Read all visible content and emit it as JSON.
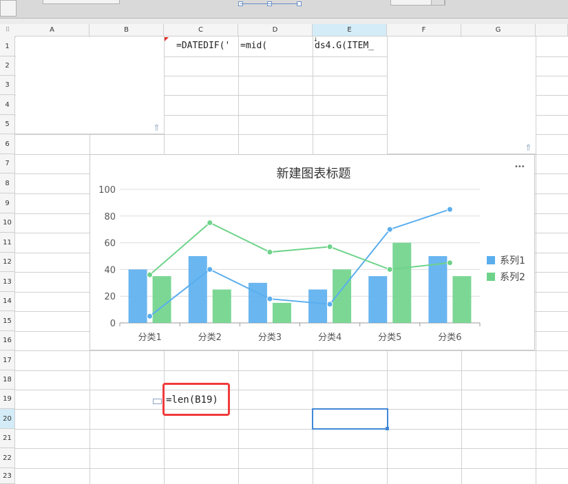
{
  "columns": [
    "A",
    "B",
    "C",
    "D",
    "E",
    "F",
    "G"
  ],
  "active_column": "E",
  "rows": [
    "1",
    "2",
    "3",
    "4",
    "5",
    "6",
    "7",
    "8",
    "9",
    "10",
    "11",
    "12",
    "13",
    "14",
    "15",
    "16",
    "17",
    "18",
    "19",
    "20",
    "21",
    "22",
    "23"
  ],
  "active_row": "20",
  "cells": {
    "C1": "=DATEDIF('",
    "D1": "=mid(",
    "E1": "ds4.G(ITEM_",
    "C19": "=len(B19)"
  },
  "icons": {
    "corner": "grid-dots-icon",
    "chart_menu": "more-options-icon",
    "anchor": "anchor-icon"
  },
  "chart_menu_glyph": "•••",
  "corner_glyph": "⠿",
  "colors": {
    "series1": "#5aaeee",
    "series2": "#6ed38a",
    "selection": "#3f87d6",
    "highlight": "#f03a3a"
  },
  "chart_data": {
    "type": "bar",
    "title": "新建图表标题",
    "categories": [
      "分类1",
      "分类2",
      "分类3",
      "分类4",
      "分类5",
      "分类6"
    ],
    "ylim": [
      0,
      100
    ],
    "yticks": [
      0,
      20,
      40,
      60,
      80,
      100
    ],
    "grid": true,
    "legend": "right",
    "series": [
      {
        "name": "系列1",
        "kind": "bar",
        "values": [
          40,
          50,
          30,
          25,
          35,
          50
        ]
      },
      {
        "name": "系列2",
        "kind": "bar",
        "values": [
          35,
          25,
          15,
          40,
          60,
          35
        ]
      },
      {
        "name": "系列1",
        "kind": "line",
        "values": [
          5,
          40,
          18,
          14,
          70,
          85
        ]
      },
      {
        "name": "系列2",
        "kind": "line",
        "values": [
          36,
          75,
          53,
          57,
          40,
          45
        ]
      }
    ]
  }
}
